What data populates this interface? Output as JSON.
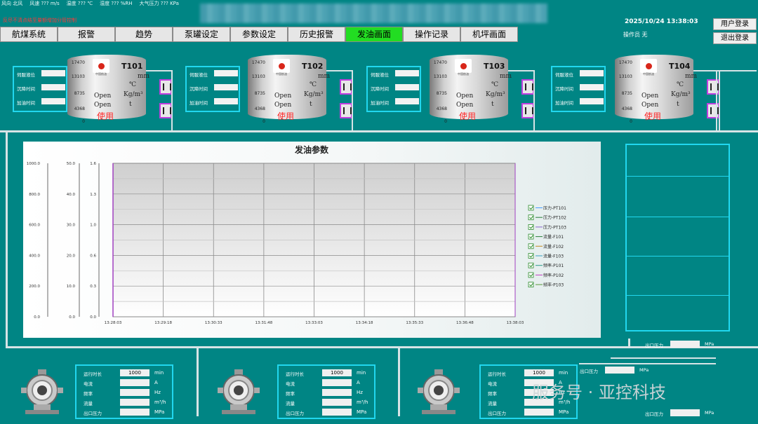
{
  "weather": {
    "items": [
      "风向  北风",
      "风速 ??? m/s",
      "温度 ??? ℃",
      "湿度 ??? %RH",
      "大气压力 ???  KPa"
    ]
  },
  "alarm_text": "反尽不清点结至量额增加分管控制",
  "datetime": "2025/10/24 13:38:03",
  "operator": "操作员 无",
  "buttons": {
    "login": "用户登录",
    "logout": "退出登录"
  },
  "nav": [
    "航煤系统",
    "报警",
    "趋势",
    "泵罐设定",
    "参数设定",
    "历史报警",
    "发油画面",
    "操作记录",
    "机坪画面"
  ],
  "nav_active_index": 6,
  "colors": {
    "background": "#008584",
    "accent_cyan": "#21d7ef",
    "active_tab": "#22dd22",
    "alarm_red": "#ff2a2a",
    "valve_frame": "#c040e0"
  },
  "tank_info_labels": [
    "伺服液位",
    "沉降时间",
    "加油时间"
  ],
  "tank_scale": [
    "17470",
    "13103",
    "8735",
    "4368",
    "0"
  ],
  "tank_logo_text": "中国航油",
  "tanks": [
    {
      "name": "T101",
      "unit_mm": "mm",
      "unit_c": "℃",
      "status1": "Open",
      "status2": "Open",
      "unit_kg": "Kg/m³",
      "unit_t": "t",
      "in_use": "使用"
    },
    {
      "name": "T102",
      "unit_mm": "mm",
      "unit_c": "℃",
      "status1": "Open",
      "status2": "Open",
      "unit_kg": "Kg/m³",
      "unit_t": "t",
      "in_use": "使用"
    },
    {
      "name": "T103",
      "unit_mm": "mm",
      "unit_c": "℃",
      "status1": "Open",
      "status2": "Open",
      "unit_kg": "Kg/m³",
      "unit_t": "t",
      "in_use": "使用"
    },
    {
      "name": "T104",
      "unit_mm": "mm",
      "unit_c": "℃",
      "status1": "Open",
      "status2": "Open",
      "unit_kg": "Kg/m³",
      "unit_t": "t",
      "in_use": "使用"
    }
  ],
  "chart_data": {
    "type": "line",
    "title": "发油参数",
    "x": [
      "13:28:03",
      "13:29:18",
      "13:30:33",
      "13:31:48",
      "13:33:03",
      "13:34:18",
      "13:35:33",
      "13:36:48",
      "13:38:03"
    ],
    "y_axes": [
      {
        "ticks": [
          "1000.0",
          "800.0",
          "600.0",
          "400.0",
          "200.0",
          "0.0"
        ],
        "ylim": [
          0,
          1000
        ]
      },
      {
        "ticks": [
          "50.0",
          "40.0",
          "30.0",
          "20.0",
          "10.0",
          "0.0"
        ],
        "ylim": [
          0,
          50
        ]
      },
      {
        "ticks": [
          "1.6",
          "1.3",
          "1.0",
          "0.6",
          "0.3",
          "0.0"
        ],
        "ylim": [
          0,
          1.6
        ]
      }
    ],
    "series": [
      {
        "name": "压力-PT101",
        "color": "#4aa0ff",
        "values": []
      },
      {
        "name": "压力-PT102",
        "color": "#2a7f3a",
        "values": []
      },
      {
        "name": "压力-PT103",
        "color": "#8866cc",
        "values": []
      },
      {
        "name": "流量-F101",
        "color": "#2a7f3a",
        "values": []
      },
      {
        "name": "流量-F102",
        "color": "#c08a20",
        "values": []
      },
      {
        "name": "流量-F103",
        "color": "#3aa0c0",
        "values": []
      },
      {
        "name": "频率-P101",
        "color": "#2a9a8a",
        "values": []
      },
      {
        "name": "频率-P102",
        "color": "#c040c0",
        "values": []
      },
      {
        "name": "频率-P103",
        "color": "#5a9a3a",
        "values": []
      }
    ],
    "grid": true,
    "legend_position": "right"
  },
  "pump_labels": [
    "运行时长",
    "电流",
    "频率",
    "流量",
    "出口压力"
  ],
  "pump_units": [
    "min",
    "A",
    "Hz",
    "m³/h",
    "MPa"
  ],
  "pumps": [
    {
      "runtime": "1000"
    },
    {
      "runtime": "1000"
    },
    {
      "runtime": "1000"
    }
  ],
  "outlet_label": "出口压力",
  "outlet_unit": "MPa",
  "watermark": "服务号 · 亚控科技"
}
